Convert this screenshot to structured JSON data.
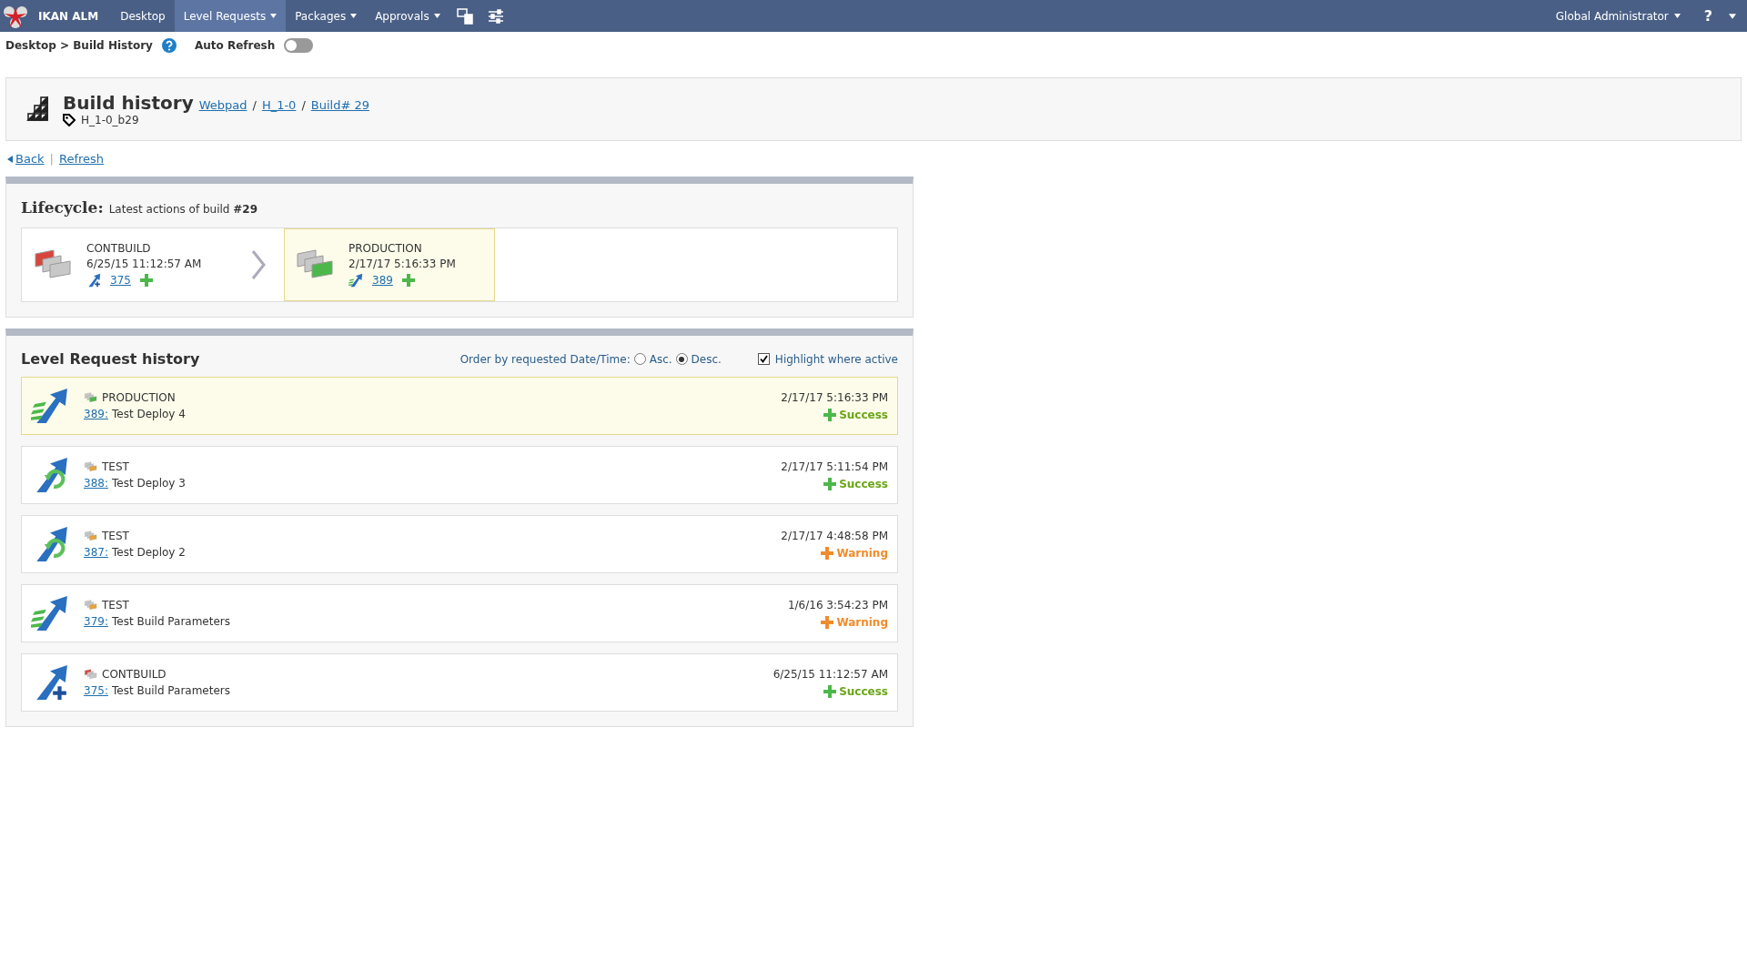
{
  "nav": {
    "brand": "IKAN ALM",
    "items": [
      {
        "label": "Desktop",
        "dropdown": false,
        "selected": false
      },
      {
        "label": "Level Requests",
        "dropdown": true,
        "selected": true
      },
      {
        "label": "Packages",
        "dropdown": true,
        "selected": false
      },
      {
        "label": "Approvals",
        "dropdown": true,
        "selected": false
      }
    ],
    "user": "Global Administrator",
    "help": "?"
  },
  "breadcrumb": "Desktop > Build History",
  "auto_refresh": {
    "label": "Auto Refresh",
    "on": false
  },
  "header": {
    "title": "Build history",
    "links": [
      {
        "label": "Webpad"
      },
      {
        "separator": "/",
        "label": "H_1-0"
      },
      {
        "separator": "/",
        "label": "Build# 29"
      }
    ],
    "tag": "H_1-0_b29"
  },
  "actions": [
    {
      "label": "Back"
    },
    {
      "separator": "|",
      "label": "Refresh"
    }
  ],
  "lifecycle": {
    "title": "Lifecycle:",
    "subtitle": "Latest actions of build **#29**",
    "stages": [
      {
        "level": "CONTBUILD",
        "kind": "build",
        "date": "6/25/15 11:12:57 AM",
        "request": "375",
        "action": {
          "kind": "build"
        },
        "result": {
          "kind": "success"
        },
        "selected": false
      },
      {
        "level": "PRODUCTION",
        "kind": "production",
        "date": "2/17/17 5:16:33 PM",
        "request": "389",
        "action": {
          "kind": "deploy"
        },
        "result": {
          "kind": "success"
        },
        "selected": true
      }
    ]
  },
  "history": {
    "title": "Level Request history",
    "order_label": "Order by requested Date/Time:",
    "order": [
      {
        "label": "Asc.",
        "selected": false
      },
      {
        "label": "Desc.",
        "selected": true
      }
    ],
    "highlight": {
      "label": "Highlight where active",
      "checked": true
    },
    "requests": [
      {
        "level": "PRODUCTION",
        "kind": "production",
        "id": "389:",
        "description": "Test Deploy 4",
        "date": "2/17/17 5:16:33 PM",
        "status": {
          "label": "Success",
          "kind": "success"
        },
        "action": {
          "kind": "deploy"
        },
        "selected": true
      },
      {
        "level": "TEST",
        "kind": "test",
        "id": "388:",
        "description": "Test Deploy 3",
        "date": "2/17/17 5:11:54 PM",
        "status": {
          "label": "Success",
          "kind": "success"
        },
        "action": {
          "kind": "redeploy"
        },
        "selected": false
      },
      {
        "level": "TEST",
        "kind": "test",
        "id": "387:",
        "description": "Test Deploy 2",
        "date": "2/17/17 4:48:58 PM",
        "status": {
          "label": "Warning",
          "kind": "warning"
        },
        "action": {
          "kind": "redeploy"
        },
        "selected": false
      },
      {
        "level": "TEST",
        "kind": "test",
        "id": "379:",
        "description": "Test Build Parameters",
        "date": "1/6/16 3:54:23 PM",
        "status": {
          "label": "Warning",
          "kind": "warning"
        },
        "action": {
          "kind": "deploy"
        },
        "selected": false
      },
      {
        "level": "CONTBUILD",
        "kind": "build",
        "id": "375:",
        "description": "Test Build Parameters",
        "date": "6/25/15 11:12:57 AM",
        "status": {
          "label": "Success",
          "kind": "success"
        },
        "action": {
          "kind": "build"
        },
        "selected": false
      }
    ]
  }
}
